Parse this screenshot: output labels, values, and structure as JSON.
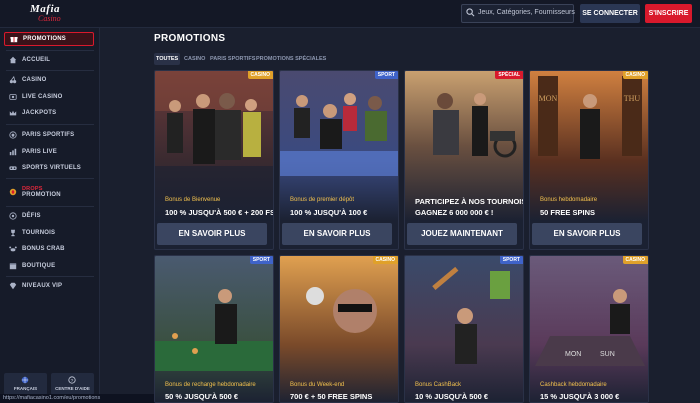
{
  "header": {
    "logo_line1": "Mafia",
    "logo_line2": "Casino",
    "search_placeholder": "Jeux, Catégories, Fournisseurs",
    "login_label": "SE CONNECTER",
    "signup_label": "S'INSCRIRE"
  },
  "sidebar": {
    "items": [
      {
        "label": "PROMOTIONS",
        "icon": "gift-icon"
      },
      {
        "label": "ACCUEIL",
        "icon": "home-icon"
      },
      {
        "label": "CASINO",
        "icon": "cherry-icon"
      },
      {
        "label": "LIVE CASINO",
        "icon": "live-icon"
      },
      {
        "label": "JACKPOTS",
        "icon": "crown-icon"
      },
      {
        "label": "PARIS SPORTIFS",
        "icon": "ball-icon"
      },
      {
        "label": "PARIS LIVE",
        "icon": "chart-icon"
      },
      {
        "label": "SPORTS VIRTUELS",
        "icon": "vr-icon"
      },
      {
        "label": "DÉFIS",
        "icon": "target-icon"
      },
      {
        "label": "TOURNOIS",
        "icon": "trophy-icon"
      },
      {
        "label": "BONUS CRAB",
        "icon": "crab-icon"
      },
      {
        "label": "BOUTIQUE",
        "icon": "shop-icon"
      },
      {
        "label": "NIVEAUX VIP",
        "icon": "diamond-icon"
      }
    ],
    "drops": {
      "line1": "DROPS",
      "line2": "PROMOTION"
    },
    "language_label": "FRANÇAIS",
    "help_label": "CENTRE D'AIDE"
  },
  "status_url": "https://mafiacasino1.com/eu/promotions",
  "page_title": "PROMOTIONS",
  "tabs": [
    "TOUTES",
    "CASINO",
    "PARIS SPORTIFS",
    "PROMOTIONS SPÉCIALES"
  ],
  "cards": [
    {
      "badge": "CASINO",
      "badge_color": "#e0a12a",
      "subtitle": "Bonus de Bienvenue",
      "title": "100 % JUSQU'À 500 € + 200 FS",
      "cta": "EN SAVOIR PLUS"
    },
    {
      "badge": "SPORT",
      "badge_color": "#3f63c9",
      "subtitle": "Bonus de premier dépôt",
      "title": "100 % JUSQU'À 100 €",
      "cta": "EN SAVOIR PLUS"
    },
    {
      "badge": "SPÉCIAL",
      "badge_color": "#d9192c",
      "subtitle": "",
      "title": "PARTICIPEZ À NOS TOURNOIS -",
      "title2": "GAGNEZ 6 000 000 € !",
      "cta": "JOUEZ MAINTENANT"
    },
    {
      "badge": "CASINO",
      "badge_color": "#e0a12a",
      "subtitle": "Bonus hebdomadaire",
      "title": "50 FREE SPINS",
      "cta": "EN SAVOIR PLUS"
    },
    {
      "badge": "SPORT",
      "badge_color": "#3f63c9",
      "subtitle": "Bonus de recharge hebdomadaire",
      "title": "50 % JUSQU'À 500 €"
    },
    {
      "badge": "CASINO",
      "badge_color": "#e0a12a",
      "subtitle": "Bonus du Week-end",
      "title": "700 € + 50 FREE SPINS"
    },
    {
      "badge": "SPORT",
      "badge_color": "#3f63c9",
      "subtitle": "Bonus CashBack",
      "title": "10 % JUSQU'À 500 €"
    },
    {
      "badge": "CASINO",
      "badge_color": "#e0a12a",
      "subtitle": "Cashback hebdomadaire",
      "title": "15 % JUSQU'À 3 000 €"
    }
  ]
}
